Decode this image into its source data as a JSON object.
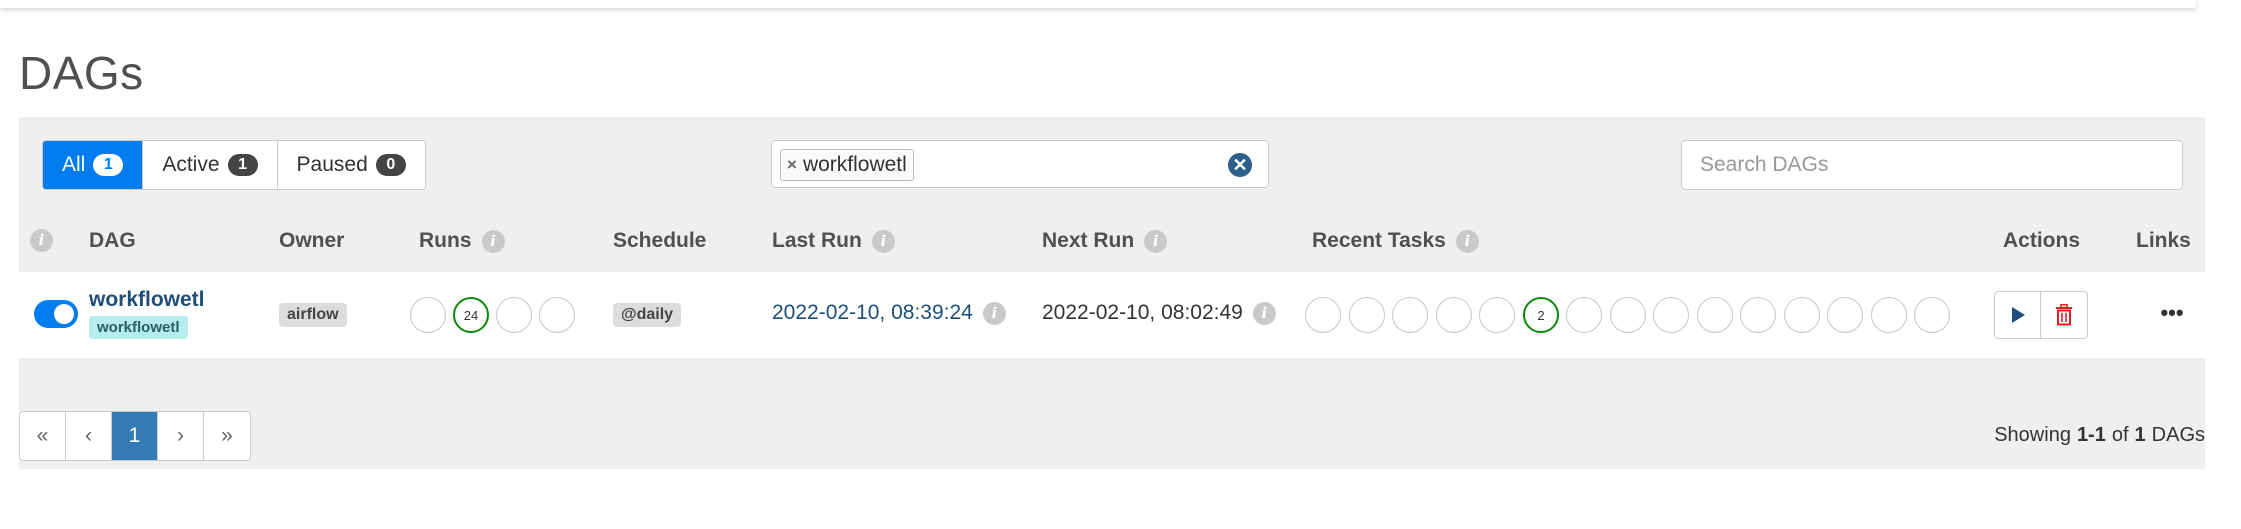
{
  "page": {
    "title": "DAGs"
  },
  "filters": {
    "all": {
      "label": "All",
      "count": "1"
    },
    "active": {
      "label": "Active",
      "count": "1"
    },
    "paused": {
      "label": "Paused",
      "count": "0"
    }
  },
  "tag_filter": {
    "chip_label": "workflowetl",
    "remove_glyph": "×",
    "clear_glyph": "✕"
  },
  "search": {
    "placeholder": "Search DAGs",
    "value": ""
  },
  "table": {
    "headers": {
      "dag": "DAG",
      "owner": "Owner",
      "runs": "Runs",
      "schedule": "Schedule",
      "last_run": "Last Run",
      "next_run": "Next Run",
      "recent_tasks": "Recent Tasks",
      "actions": "Actions",
      "links": "Links"
    },
    "info_glyph": "i",
    "rows": [
      {
        "dag_id": "workflowetl",
        "tag": "workflowetl",
        "owner": "airflow",
        "active": true,
        "runs": [
          "",
          "24",
          "",
          ""
        ],
        "schedule": "@daily",
        "last_run": "2022-02-10, 08:39:24",
        "next_run": "2022-02-10, 08:02:49",
        "recent_tasks": [
          "",
          "",
          "",
          "",
          "",
          "2",
          "",
          "",
          "",
          "",
          "",
          "",
          "",
          "",
          ""
        ]
      }
    ]
  },
  "icons": {
    "trigger": "play-icon",
    "delete": "trash-icon",
    "links": "ellipsis-icon"
  },
  "links_glyph": "•••",
  "colors": {
    "primary": "#017cee",
    "success": "#008000",
    "danger": "#e02020",
    "link": "#1f4e79",
    "pagination_active": "#337ab7"
  },
  "pagination": {
    "first": "«",
    "prev": "‹",
    "current": "1",
    "next": "›",
    "last": "»"
  },
  "summary": {
    "prefix": "Showing",
    "range": "1-1",
    "of": "of",
    "total": "1",
    "suffix": "DAGs"
  }
}
